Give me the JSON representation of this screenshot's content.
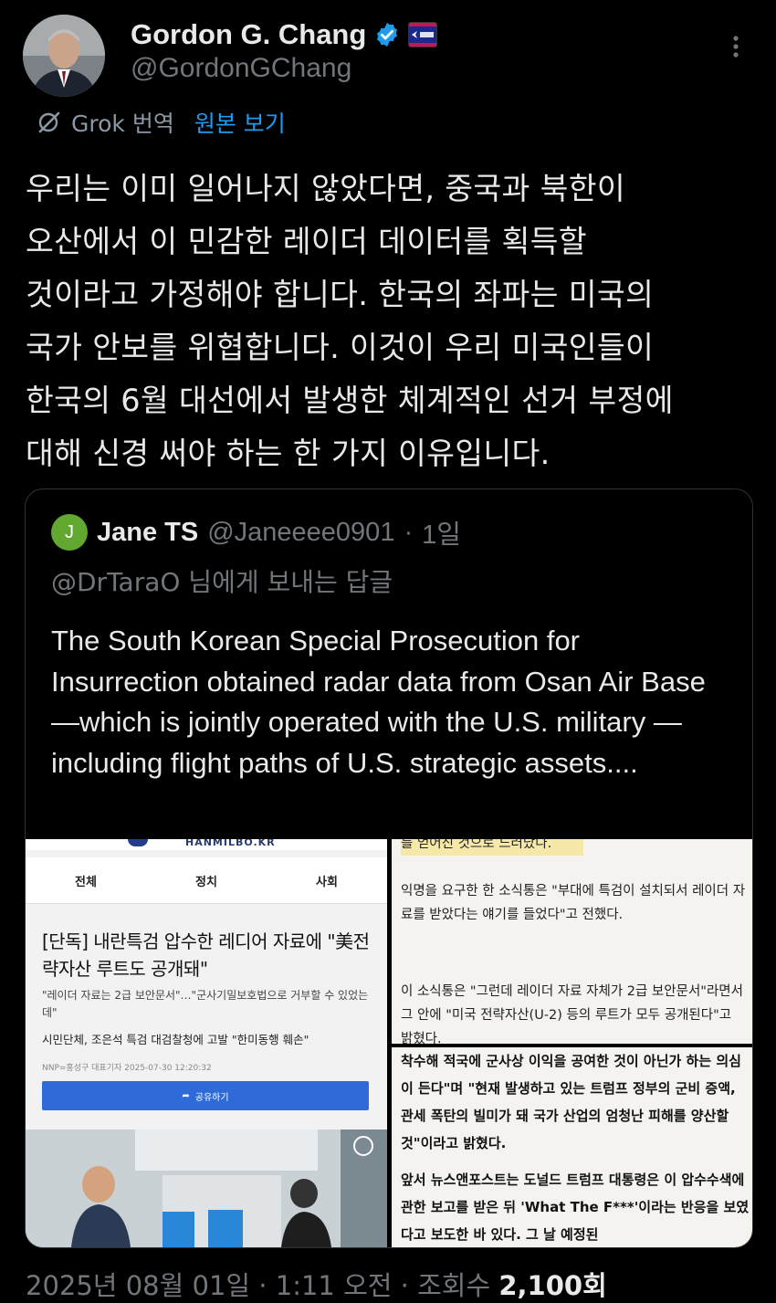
{
  "author": {
    "name": "Gordon G. Chang",
    "handle": "@GordonGChang"
  },
  "translate": {
    "label": "Grok 번역",
    "original_link": "원본 보기"
  },
  "tweet": {
    "text": "우리는 이미 일어나지 않았다면, 중국과 북한이\n오산에서 이 민감한 레이더 데이터를 획득할\n것이라고 가정해야 합니다. 한국의 좌파는 미국의\n국가 안보를 위협합니다. 이것이 우리 미국인들이\n한국의 6월 대선에서 발생한 체계적인 선거 부정에\n대해 신경 써야 하는 한 가지 이유입니다."
  },
  "quote": {
    "avatar_letter": "J",
    "name": "Jane TS",
    "handle": "@Janeeee0901",
    "separator": "·",
    "time": "1일",
    "reply_to": "@DrTaraO 님에게 보내는 답글",
    "text": "The South Korean Special Prosecution for Insurrection obtained radar data from Osan Air Base —which is jointly operated with the U.S. military —including flight paths of U.S. strategic assets...."
  },
  "media": {
    "left": {
      "site": "HANMILBO.KR",
      "tabs": [
        "전체",
        "정치",
        "사회"
      ],
      "headline": "[단독] 내란특검 압수한 레디어 자료에 \"美전략자산 루트도 공개돼\"",
      "sub": "\"레이더 자료는 2급 보안문서\"…\"군사기밀보호법으로 거부할 수 있었는데\"",
      "sub2": "시민단체, 조은석 특검 대검찰청에 고발 \"한미동행 훼손\"",
      "byline": "NNP=홍성구 대표기자  2025-07-30 12:20:32",
      "share": "공유하기"
    },
    "top_right": {
      "p0": "를 얻어진 것으로 드러났다.",
      "p1": "익명을 요구한 한 소식통은 \"부대에 특검이 설치되서 레이더 자료를 받았다는 얘기를 들었다\"고 전했다.",
      "p2": "이 소식통은 \"그런데 레이더 자료 자체가 2급 보안문서\"라면서 그 안에 \"미국 전략자산(U-2) 등의 루트가 모두 공개된다\"고 밝혔다."
    },
    "bottom_right": {
      "p1": "착수해 적국에 군사상 이익을 공여한 것이 아닌가 하는 의심이 든다\"며 \"현재 발생하고 있는 트럼프 정부의 군비 증액, 관세 폭탄의 빌미가 돼 국가 산업의 엄청난 피해를 양산할 것\"이라고 밝혔다.",
      "p2": "앞서 뉴스앤포스트는 도널드 트럼프 대통령은 이 압수수색에 관한 보고를 받은 뒤 'What The F***'이라는 반응을 보였다고 보도한 바 있다. 그 날 예정된"
    }
  },
  "footer": {
    "timestamp": "2025년 08월 01일 · 1:11 오전 · 조회수 ",
    "views": "2,100회"
  },
  "colors": {
    "background": "#000000",
    "text": "#e7e9ea",
    "secondary": "#71767b",
    "link": "#1d9bf0",
    "verified": "#1d9bf0"
  }
}
